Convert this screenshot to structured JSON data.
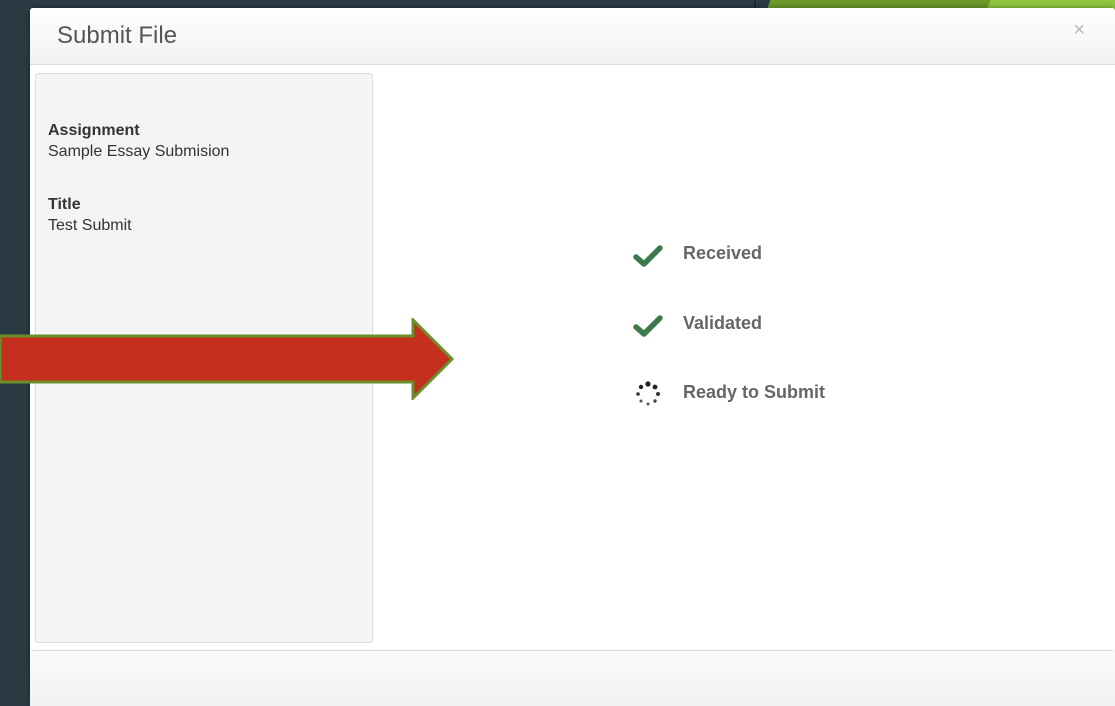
{
  "modal": {
    "title": "Submit File",
    "close_glyph": "×"
  },
  "details": {
    "assignment_label": "Assignment",
    "assignment_value": "Sample Essay Submision",
    "title_label": "Title",
    "title_value": "Test Submit"
  },
  "status": [
    {
      "label": "Received",
      "icon": "checkmark-icon",
      "state": "done"
    },
    {
      "label": "Validated",
      "icon": "checkmark-icon",
      "state": "done"
    },
    {
      "label": "Ready to Submit",
      "icon": "spinner-icon",
      "state": "in-progress"
    }
  ],
  "colors": {
    "check": "#3c7a4d",
    "arrow_fill": "#c42e1c",
    "arrow_stroke": "#6a8f2a",
    "background": "#2a3b44",
    "accent_green": "#8dc63f"
  }
}
